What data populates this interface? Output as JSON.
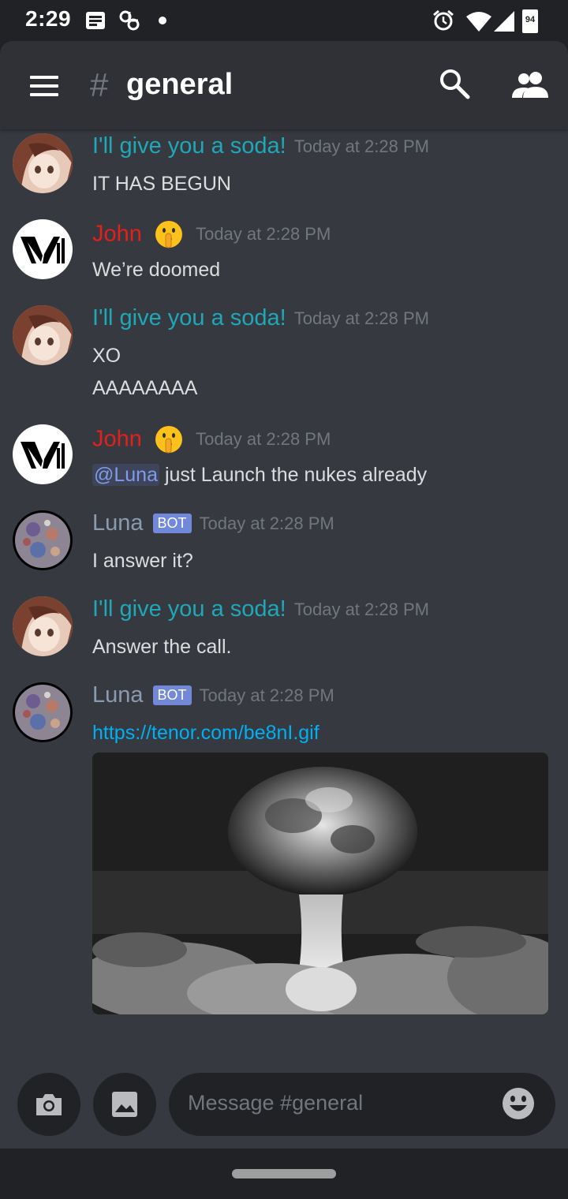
{
  "status_bar": {
    "time": "2:29",
    "battery": "94"
  },
  "header": {
    "hash": "#",
    "channel": "general"
  },
  "messages": [
    {
      "author": "I'll give you a soda!",
      "timestamp": "Today at 2:28 PM",
      "lines": [
        "IT HAS BEGUN"
      ],
      "avatar": "anime-girl-avatar"
    },
    {
      "author": "John",
      "timestamp": "Today at 2:28 PM",
      "lines": [
        "We’re doomed"
      ],
      "avatar": "v-logo-avatar",
      "emoji": "shushing-face"
    },
    {
      "author": "I'll give you a soda!",
      "timestamp": "Today at 2:28 PM",
      "lines": [
        "XO",
        "AAAAAAAA"
      ],
      "avatar": "anime-girl-avatar"
    },
    {
      "author": "John",
      "timestamp": "Today at 2:28 PM",
      "mention": "@Luna",
      "text_after_mention": " just Launch the nukes already",
      "avatar": "v-logo-avatar",
      "emoji": "shushing-face"
    },
    {
      "author": "Luna",
      "bot_tag": "BOT",
      "timestamp": "Today at 2:28 PM",
      "lines": [
        "I answer it?"
      ],
      "avatar": "moon-avatar"
    },
    {
      "author": "I'll give you a soda!",
      "timestamp": "Today at 2:28 PM",
      "lines": [
        "Answer the call."
      ],
      "avatar": "anime-girl-avatar"
    },
    {
      "author": "Luna",
      "bot_tag": "BOT",
      "timestamp": "Today at 2:28 PM",
      "link": "https://tenor.com/be8nI.gif",
      "avatar": "moon-avatar",
      "embed": "mushroom-cloud-gif"
    }
  ],
  "input": {
    "placeholder": "Message #general"
  },
  "colors": {
    "background": "#36393f",
    "header": "#2f3136",
    "soda_name": "#1fa8b8",
    "john_name": "#e3201b",
    "luna_name": "#8a9bb0",
    "bot_tag": "#7289da",
    "link": "#00b0f4",
    "mention": "#7f9bea"
  }
}
